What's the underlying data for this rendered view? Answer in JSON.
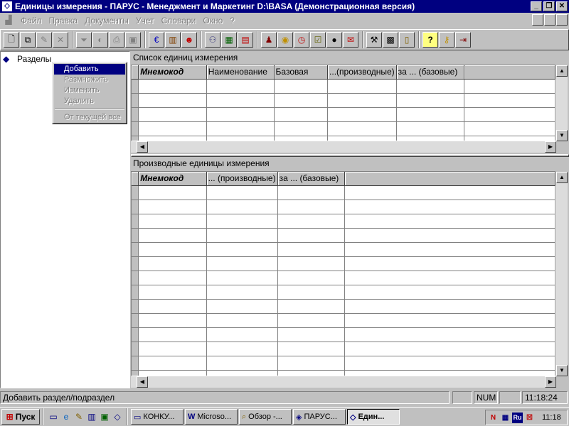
{
  "window": {
    "title": "Единицы измерения - ПАРУС - Менеджмент и Маркетинг  D:\\BASA (Демонстрационная версия)",
    "minimize": "_",
    "restore": "❐",
    "close": "✕"
  },
  "menu": {
    "items": [
      {
        "label": "Файл"
      },
      {
        "label": "Правка"
      },
      {
        "label": "Документы"
      },
      {
        "label": "Учет"
      },
      {
        "label": "Словари"
      },
      {
        "label": "Окно"
      },
      {
        "label": "?"
      }
    ]
  },
  "toolbar": {
    "groups": [
      [
        "new-doc-icon",
        "copy-doc-icon",
        "edit-doc-icon",
        "delete-icon"
      ],
      [
        "filter-icon",
        "filter-clear-icon",
        "print-icon",
        "box-icon"
      ],
      [
        "currency-icon",
        "book-icon",
        "people-icon"
      ],
      [
        "handshake-icon",
        "calc-sheet-icon",
        "document-chart-icon"
      ],
      [
        "person-icon",
        "coin-icon",
        "clock-icon",
        "checklist-icon",
        "bomb-icon",
        "mail-icon"
      ],
      [
        "tools-icon",
        "calculator-icon",
        "notepad-icon"
      ],
      [
        "help-icon",
        "key-icon",
        "exit-icon"
      ]
    ]
  },
  "tree": {
    "root_label": "Разделы"
  },
  "context_menu": {
    "items": [
      {
        "label": "Добавить",
        "state": "selected"
      },
      {
        "label": "Размножить",
        "state": "disabled"
      },
      {
        "label": "Изменить",
        "state": "disabled"
      },
      {
        "label": "Удалить",
        "state": "disabled"
      },
      {
        "label": "От текущей все",
        "state": "disabled"
      }
    ]
  },
  "top_panel": {
    "title": "Список единиц измерения",
    "columns": [
      "Мнемокод",
      "Наименование",
      "Базовая",
      "...(производные)",
      "за ... (базовые)"
    ]
  },
  "bottom_panel": {
    "title": "Производные единицы измерения",
    "columns": [
      "Мнемокод",
      "... (производные)",
      "за ... (базовые)"
    ]
  },
  "statusbar": {
    "message": "Добавить раздел/подраздел",
    "num": "NUM",
    "time": "11:18:24"
  },
  "taskbar": {
    "start_label": "Пуск",
    "tasks": [
      {
        "label": "КОНКУ..."
      },
      {
        "label": "Microso..."
      },
      {
        "label": "Обзор -..."
      },
      {
        "label": "ПАРУС..."
      },
      {
        "label": "Един..."
      }
    ],
    "clock": "11:18",
    "lang": "Ru"
  },
  "colors": {
    "title_bar": "#000080",
    "face": "#c0c0c0",
    "selection": "#000080"
  }
}
